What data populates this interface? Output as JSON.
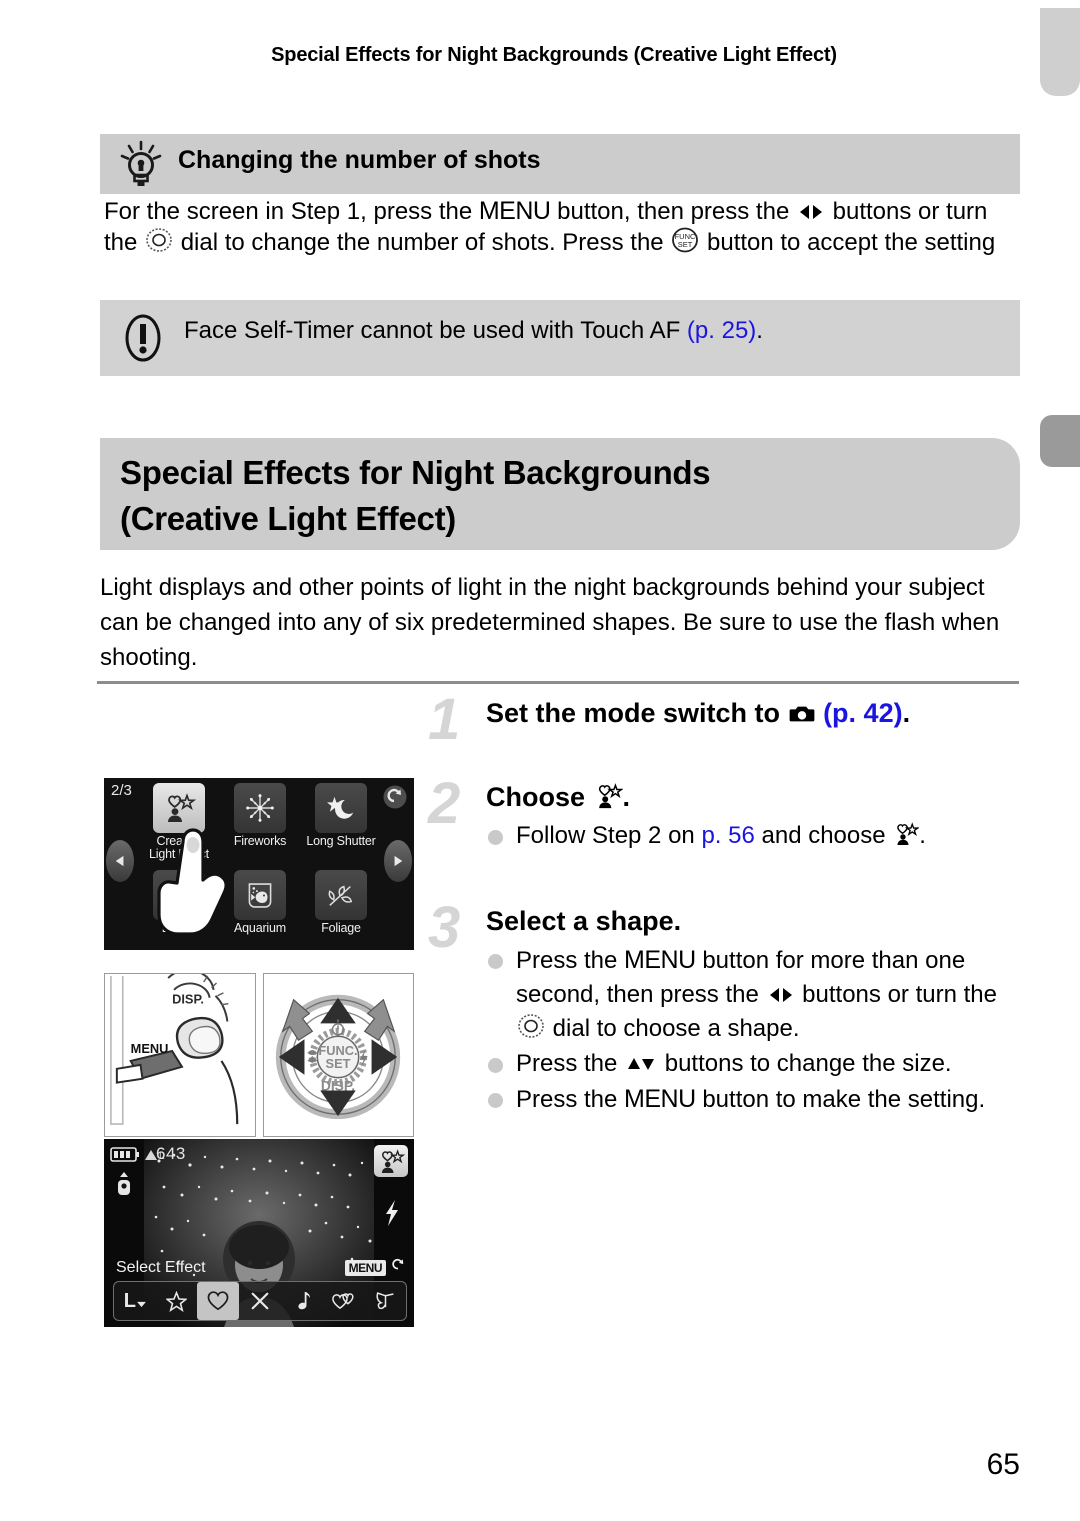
{
  "running_header": "Special Effects for Night Backgrounds (Creative Light Effect)",
  "tip": {
    "icon": "lightbulb-icon",
    "title": "Changing the number of shots",
    "body_part1": "For the screen in Step 1, press the ",
    "menu_label": "MENU",
    "body_part2": " button, then press the ",
    "body_part3": " buttons or turn the ",
    "body_part4": " dial to change the number of shots. Press the ",
    "body_part5": " button to accept the setting"
  },
  "warning": {
    "icon": "exclamation-icon",
    "text": "Face Self-Timer cannot be used with Touch AF ",
    "ref": "(p. 25)",
    "period": "."
  },
  "chapter": {
    "title_line1": "Special Effects for Night Backgrounds",
    "title_line2": "(Creative Light Effect)"
  },
  "intro": "Light displays and other points of light in the night backgrounds behind your subject can be changed into any of six predetermined shapes. Be sure to use the flash when shooting.",
  "steps": [
    {
      "number": "1",
      "title_part1": "Set the mode switch to ",
      "title_icon": "camera-mode-icon",
      "title_part2": " ",
      "ref": "(p. 42)",
      "title_part3": ".",
      "bullets": []
    },
    {
      "number": "2",
      "title_part1": "Choose ",
      "title_icon": "creative-light-effect-icon",
      "title_part2": ".",
      "bullets": [
        {
          "part1": "Follow Step 2 on ",
          "ref": "p. 56",
          "part2": " and choose ",
          "icon": "creative-light-effect-icon",
          "part3": "."
        }
      ]
    },
    {
      "number": "3",
      "title_part1": "Select a shape.",
      "bullets": [
        {
          "part1": "Press the ",
          "menu1": "MENU",
          "part2": " button for more than one second, then press the ",
          "icon1": "left-right-buttons-icon",
          "part3": " buttons or turn the ",
          "icon2": "control-dial-icon",
          "part4": " dial to choose a shape."
        },
        {
          "part1": "Press the ",
          "icon1": "up-down-buttons-icon",
          "part2": " buttons to change the size."
        },
        {
          "part1": "Press the ",
          "menu1": "MENU",
          "part2": " button to make the setting."
        }
      ]
    }
  ],
  "figures": {
    "scene_screen": {
      "page_indicator": "2/3",
      "modes": [
        {
          "label_line1": "Creative",
          "label_line2": "Light Effect",
          "icon": "creative-light-effect-icon",
          "selected": true
        },
        {
          "label_line1": "Fireworks",
          "label_line2": "",
          "icon": "fireworks-icon",
          "selected": false
        },
        {
          "label_line1": "Long Shutter",
          "label_line2": "",
          "icon": "long-shutter-icon",
          "selected": false
        },
        {
          "label_line1": "Beach",
          "label_line2": "",
          "icon": "beach-icon",
          "selected": false
        },
        {
          "label_line1": "Aquarium",
          "label_line2": "",
          "icon": "aquarium-icon",
          "selected": false
        },
        {
          "label_line1": "Foliage",
          "label_line2": "",
          "icon": "foliage-icon",
          "selected": false
        }
      ],
      "prev_arrow": "left-arrow-icon",
      "next_arrow": "right-arrow-icon",
      "back_button": "return-arrow-icon",
      "pointer": "finger-pointer-icon"
    },
    "menu_diagram": {
      "button_label": "MENU",
      "dial_label": "DISP."
    },
    "dial_diagram": {
      "center_line1": "FUNC.",
      "center_line2": "SET",
      "bottom_label": "DISP.",
      "timer_icon": "self-timer-icon",
      "macro_icon": "macro-icon",
      "flash_icon": "flash-icon"
    },
    "photo_screen": {
      "battery": "battery-icon",
      "mode_icon": "image-stabilizer-icon",
      "quality": "image-quality-icon",
      "shots_remaining": "643",
      "mode_badge": "creative-light-effect-icon",
      "flash": "flash-icon",
      "status_text": "Select Effect",
      "menu_return_label": "MENU",
      "menu_return_icon": "return-arrow-icon",
      "toolbar": [
        {
          "name": "size-selector",
          "label": "L",
          "icon": "size-dropdown-icon",
          "selected": false
        },
        {
          "name": "star-shape",
          "label": "",
          "icon": "star-icon",
          "selected": false
        },
        {
          "name": "heart-shape",
          "label": "",
          "icon": "heart-icon",
          "selected": true
        },
        {
          "name": "cross-shape",
          "label": "",
          "icon": "cross-icon",
          "selected": false
        },
        {
          "name": "note-shape",
          "label": "",
          "icon": "music-note-icon",
          "selected": false
        },
        {
          "name": "double-heart-shape",
          "label": "",
          "icon": "double-heart-icon",
          "selected": false
        },
        {
          "name": "butterfly-shape",
          "label": "",
          "icon": "butterfly-icon",
          "selected": false
        }
      ]
    }
  },
  "page_number": "65",
  "colors": {
    "box_gray": "#cccccc",
    "link_blue": "#1b15e0",
    "step_number_gray": "#d5d5d5"
  }
}
